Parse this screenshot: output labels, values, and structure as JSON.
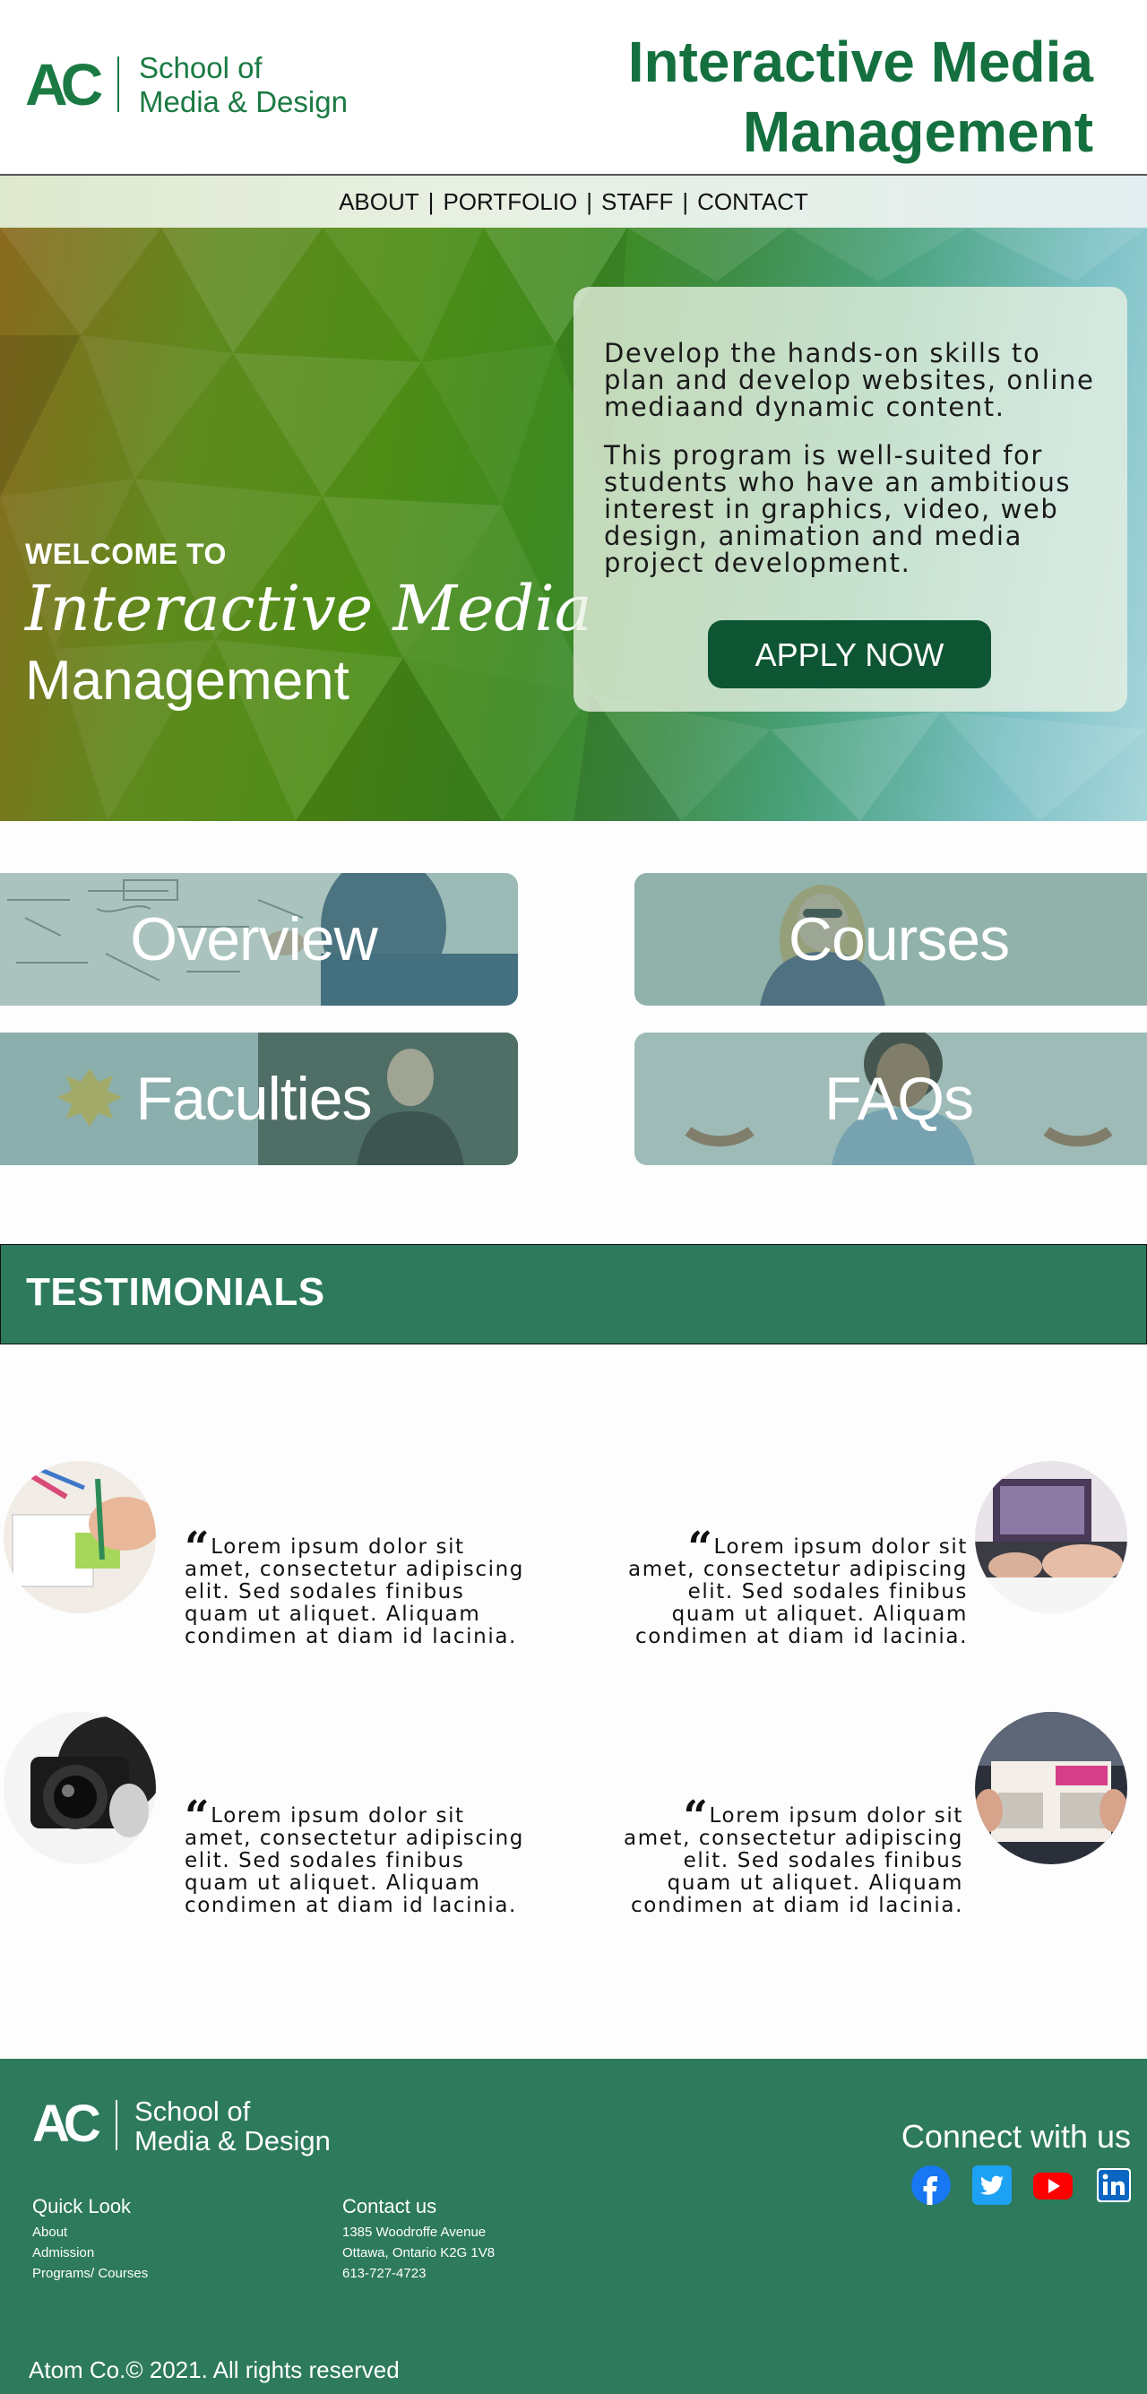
{
  "header": {
    "logo": {
      "mark": "AC",
      "text": "School of\nMedia & Design"
    },
    "title": "Interactive Media\nManagement"
  },
  "nav": {
    "items": [
      "ABOUT",
      "PORTFOLIO",
      "STAFF",
      "CONTACT"
    ],
    "separator": "|"
  },
  "hero": {
    "welcome": "WELCOME TO",
    "title_script": "Interactive Media",
    "title_sub": "Management",
    "paragraph1": "Develop the hands-on skills to plan and develop websites, online mediaand dynamic content.",
    "paragraph2": "This program is well-suited for students who have an ambitious interest in graphics, video, web design, animation and media project development.",
    "apply_label": "APPLY NOW"
  },
  "tiles": {
    "overview": "Overview",
    "courses": "Courses",
    "faculties": "Faculties",
    "faqs": "FAQs"
  },
  "testimonials": {
    "title": "TESTIMONIALS",
    "quote_mark": "“",
    "items": [
      {
        "text": "Lorem ipsum dolor sit amet, consectetur adipiscing elit. Sed sodales finibus quam ut aliquet. Aliquam condimen at diam id lacinia.",
        "image": "drawing-hand"
      },
      {
        "text": "Lorem ipsum dolor sit amet, consectetur adipiscing elit. Sed sodales finibus quam ut aliquet. Aliquam condimen at diam id lacinia.",
        "image": "laptop-hands"
      },
      {
        "text": "Lorem ipsum dolor sit amet, consectetur adipiscing elit. Sed sodales finibus quam ut aliquet. Aliquam condimen at diam id lacinia.",
        "image": "camera-photographer"
      },
      {
        "text": "Lorem ipsum dolor sit amet, consectetur adipiscing elit. Sed sodales finibus quam ut aliquet. Aliquam condimen at diam id lacinia.",
        "image": "python-book-reader"
      }
    ]
  },
  "footer": {
    "logo": {
      "mark": "AC",
      "text": "School of\nMedia & Design"
    },
    "connect": "Connect with us",
    "social": [
      "facebook-icon",
      "twitter-icon",
      "youtube-icon",
      "linkedin-icon"
    ],
    "quick_look": {
      "title": "Quick Look",
      "links": [
        "About",
        "Admission",
        "Programs/ Courses"
      ]
    },
    "contact": {
      "title": "Contact us",
      "lines": [
        "1385 Woodroffe Avenue",
        "Ottawa, Ontario K2G 1V8",
        "613-727-4723"
      ]
    },
    "copyright": "Atom Co.© 2021. All rights reserved"
  },
  "colors": {
    "brand_green": "#1b7a43",
    "footer_green": "#2d7a5d",
    "button_green": "#0d5533"
  }
}
